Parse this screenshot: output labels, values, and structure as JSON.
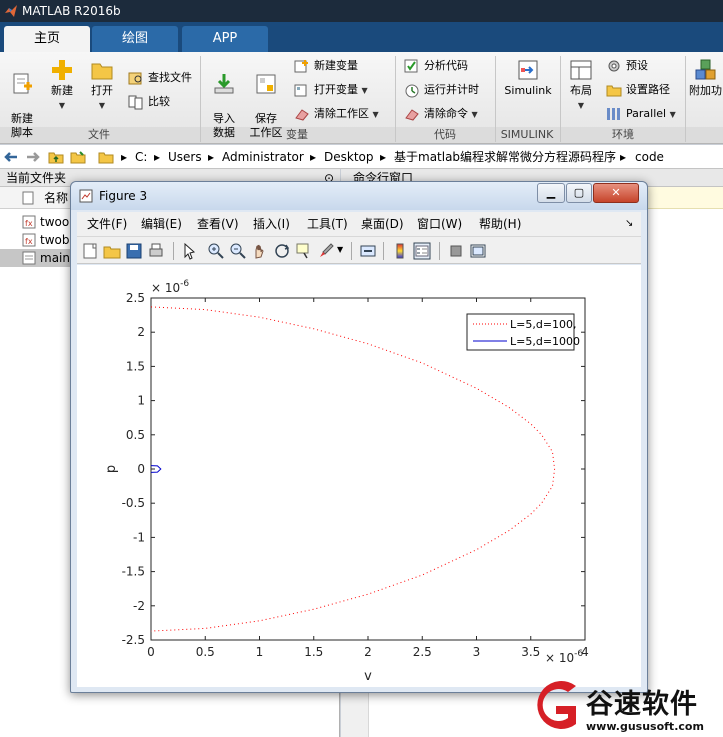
{
  "app": {
    "title": "MATLAB R2016b"
  },
  "ribbon_tabs": [
    {
      "label": "主页",
      "active": true
    },
    {
      "label": "绘图",
      "active": false
    },
    {
      "label": "APP",
      "active": false
    }
  ],
  "ribbon": {
    "file_group": {
      "label": "文件",
      "new_script": "新建\n脚本",
      "new": "新建",
      "open": "打开",
      "find_files": "查找文件",
      "compare": "比较"
    },
    "variable_group": {
      "label": "变量",
      "import_data": "导入\n数据",
      "save_workspace": "保存\n工作区",
      "new_variable": "新建变量",
      "open_variable": "打开变量",
      "clear_workspace": "清除工作区"
    },
    "code_group": {
      "label": "代码",
      "analyze_code": "分析代码",
      "run_and_time": "运行并计时",
      "clear_commands": "清除命令"
    },
    "simulink_group": {
      "label": "SIMULINK",
      "simulink": "Simulink"
    },
    "env_group": {
      "label": "环境",
      "layout": "布局",
      "preferences": "预设",
      "set_path": "设置路径",
      "parallel": "Parallel",
      "addons": "附加功"
    }
  },
  "address_bar": {
    "path": [
      "C:",
      "Users",
      "Administrator",
      "Desktop",
      "基于matlab编程求解常微分方程源码程序",
      "code"
    ]
  },
  "file_panel": {
    "title": "当前文件夹",
    "column_name": "名称",
    "files": [
      {
        "name": "twoo",
        "selected": false
      },
      {
        "name": "twob",
        "selected": false
      },
      {
        "name": "main",
        "selected": true
      }
    ]
  },
  "command_panel": {
    "title": "命令行窗口"
  },
  "figure": {
    "title": "Figure 3",
    "menus": [
      "文件(F)",
      "编辑(E)",
      "查看(V)",
      "插入(I)",
      "工具(T)",
      "桌面(D)",
      "窗口(W)",
      "帮助(H)"
    ],
    "menu_overflow": "↘"
  },
  "chart_data": {
    "type": "line",
    "xlabel": "v",
    "ylabel": "p",
    "x_exponent_label": "× 10^-6",
    "y_exponent_label": "× 10^-6",
    "xlim": [
      0,
      4
    ],
    "ylim": [
      -2.5,
      2.5
    ],
    "x_ticks": [
      "0",
      "0.5",
      "1",
      "1.5",
      "2",
      "2.5",
      "3",
      "3.5",
      "4"
    ],
    "y_ticks": [
      "2.5",
      "2",
      "1.5",
      "1",
      "0.5",
      "0",
      "-0.5",
      "-1",
      "-1.5",
      "-2",
      "-2.5"
    ],
    "legend_position": "top-right",
    "series": [
      {
        "name": "L=5,d=100,",
        "color": "#ff0000",
        "style": "dotted",
        "x": [
          0,
          0.5,
          1,
          1.5,
          2,
          2.5,
          3,
          3.3,
          3.5,
          3.6,
          3.7,
          3.72,
          3.7,
          3.6,
          3.5,
          3.3,
          3,
          2.5,
          2,
          1.5,
          1,
          0.5,
          0
        ],
        "y": [
          2.37,
          2.33,
          2.22,
          2.05,
          1.83,
          1.55,
          1.18,
          0.9,
          0.66,
          0.5,
          0.25,
          0,
          -0.25,
          -0.5,
          -0.66,
          -0.9,
          -1.18,
          -1.55,
          -1.83,
          -2.05,
          -2.22,
          -2.33,
          -2.37
        ]
      },
      {
        "name": "L=5,d=1000",
        "color": "#0000cc",
        "style": "solid",
        "x": [
          0,
          0.06,
          0.09,
          0.06,
          0,
          0.06,
          0.09,
          0.06,
          0
        ],
        "y": [
          0.05,
          0.045,
          0,
          -0.045,
          -0.05,
          -0.045,
          0,
          0.045,
          0.05
        ]
      }
    ]
  },
  "watermark": {
    "brand": "谷速软件",
    "url": "www.gususoft.com"
  }
}
